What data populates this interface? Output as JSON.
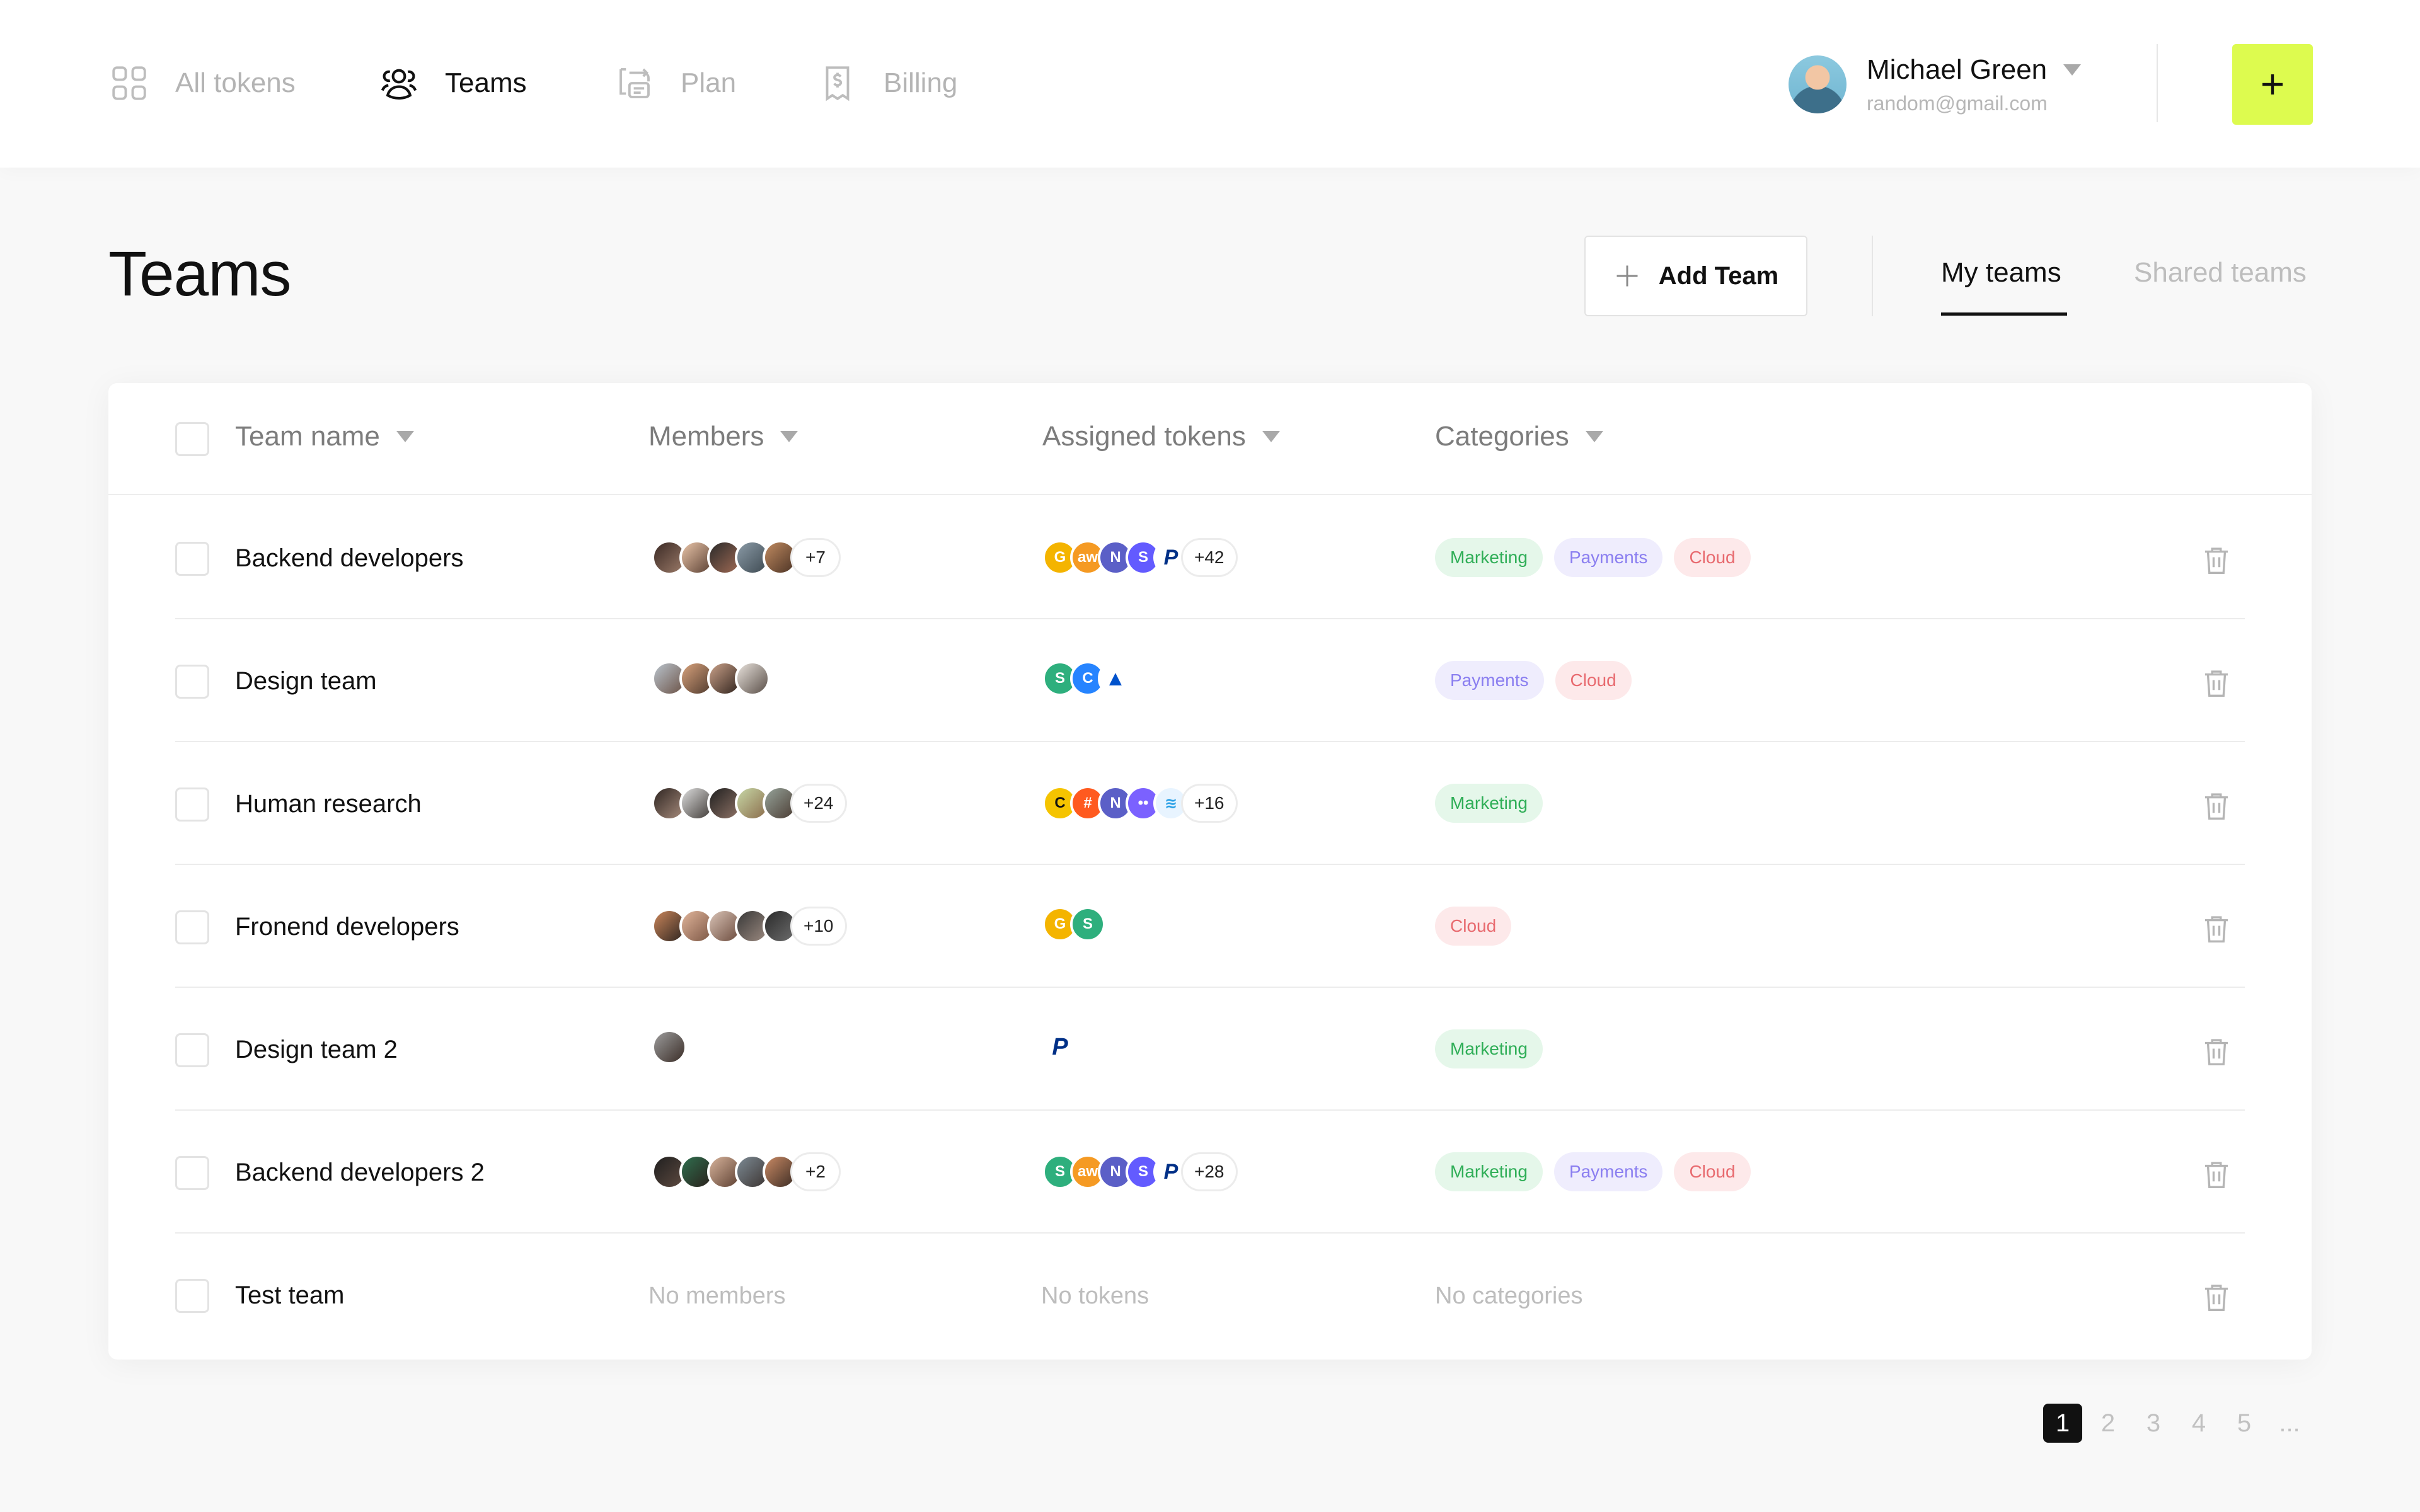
{
  "nav": {
    "items": [
      {
        "label": "All tokens",
        "icon": "grid-icon",
        "active": false
      },
      {
        "label": "Teams",
        "icon": "users-icon",
        "active": true
      },
      {
        "label": "Plan",
        "icon": "plan-icon",
        "active": false
      },
      {
        "label": "Billing",
        "icon": "receipt-icon",
        "active": false
      }
    ]
  },
  "user": {
    "name": "Michael Green",
    "email": "random@gmail.com"
  },
  "accent_color": "#ddfb4f",
  "page": {
    "title": "Teams",
    "add_team_label": "Add Team",
    "tabs": [
      {
        "label": "My teams",
        "active": true
      },
      {
        "label": "Shared teams",
        "active": false
      }
    ]
  },
  "table": {
    "columns": [
      "Team name",
      "Members",
      "Assigned tokens",
      "Categories"
    ],
    "rows": [
      {
        "name": "Backend developers",
        "members_more": "+7",
        "tokens_more": "+42",
        "categories": [
          "Marketing",
          "Payments",
          "Cloud"
        ]
      },
      {
        "name": "Design team",
        "members_more": "",
        "tokens_more": "",
        "categories": [
          "Payments",
          "Cloud"
        ]
      },
      {
        "name": "Human research",
        "members_more": "+24",
        "tokens_more": "+16",
        "categories": [
          "Marketing"
        ]
      },
      {
        "name": "Fronend developers",
        "members_more": "+10",
        "tokens_more": "",
        "categories": [
          "Cloud"
        ]
      },
      {
        "name": "Design team 2",
        "members_more": "",
        "tokens_more": "",
        "categories": [
          "Marketing"
        ]
      },
      {
        "name": "Backend developers 2",
        "members_more": "+2",
        "tokens_more": "+28",
        "categories": [
          "Marketing",
          "Payments",
          "Cloud"
        ]
      },
      {
        "name": "Test team",
        "members_empty": "No members",
        "tokens_empty": "No tokens",
        "categories_empty": "No categories"
      }
    ]
  },
  "pagination": {
    "pages": [
      "1",
      "2",
      "3",
      "4",
      "5",
      "..."
    ],
    "current": "1"
  }
}
